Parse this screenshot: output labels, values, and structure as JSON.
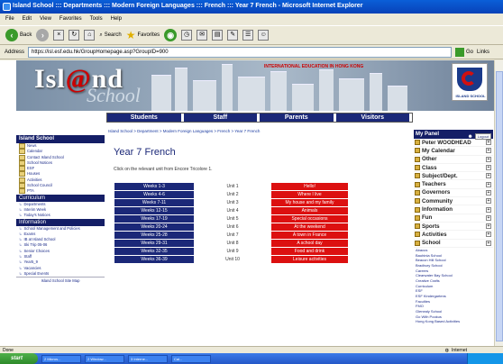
{
  "window": {
    "title": "Island School ::: Departments ::: Modern Foreign Languages ::: French ::: Year 7 French - Microsoft Internet Explorer"
  },
  "menu": [
    "File",
    "Edit",
    "View",
    "Favorites",
    "Tools",
    "Help"
  ],
  "toolbar": {
    "back": "Back",
    "search": "Search",
    "favorites": "Favorites"
  },
  "address": {
    "label": "Address",
    "url": "https://isl.esf.edu.hk/GroupHomepage.asp?GroupID=900",
    "go": "Go",
    "links": "Links"
  },
  "banner": {
    "logo_main": "Isl",
    "logo_at": "@",
    "logo_end": "nd",
    "logo_sub": "School",
    "slogan": "INTERNATIONAL EDUCATION IN HONG KONG",
    "crest_text": "ISLAND SCHOOL"
  },
  "nav": [
    "Students",
    "Staff",
    "Parents",
    "Visitors"
  ],
  "breadcrumb": "Island School > Department > Modern Foreign Languages > French > Year 7 French",
  "sidebar": {
    "title": "Island School",
    "school_items": [
      "News",
      "Calendar",
      "Contact Island School",
      "School Notices",
      "ESF",
      "Houses",
      "Activities",
      "School Council",
      "PTA"
    ],
    "curriculum_title": "Curriculum",
    "curriculum_items": [
      "Departments",
      "Interim Week",
      "Today's Notices"
    ],
    "information_title": "Information",
    "information_items": [
      "School Management and Policies",
      "Exams",
      "IB at Island School",
      "Ski Trip 05-06",
      "Senior Choices",
      "Staff",
      "Year5_9",
      "Vacancies",
      "Special Events"
    ],
    "footer": "Island School Site Map"
  },
  "main": {
    "title": "Year 7 French",
    "intro": "Click on the relevant unit from Encore Tricolore 1.",
    "rows": [
      {
        "weeks": "Weeks 1-3",
        "unit": "Unit 1",
        "topic": "Hello!"
      },
      {
        "weeks": "Weeks 4-6",
        "unit": "Unit 2",
        "topic": "Where I live"
      },
      {
        "weeks": "Weeks 7-11",
        "unit": "Unit 3",
        "topic": "My house and my family"
      },
      {
        "weeks": "Weeks 12-15",
        "unit": "Unit 4",
        "topic": "Animals"
      },
      {
        "weeks": "Weeks 17-19",
        "unit": "Unit 5",
        "topic": "Special occasions"
      },
      {
        "weeks": "Weeks 20-24",
        "unit": "Unit 6",
        "topic": "At the weekend"
      },
      {
        "weeks": "Weeks 25-28",
        "unit": "Unit 7",
        "topic": "A town in France"
      },
      {
        "weeks": "Weeks 29-31",
        "unit": "Unit 8",
        "topic": "A school day"
      },
      {
        "weeks": "Weeks 32-35",
        "unit": "Unit 9",
        "topic": "Food and drink"
      },
      {
        "weeks": "Weeks 36-39",
        "unit": "Unit 10",
        "topic": "Leisure activities"
      }
    ]
  },
  "panel": {
    "title": "My Panel",
    "logout": "Logout",
    "items": [
      "Peter WOODHEAD",
      "My Calendar",
      "Other",
      "Class",
      "Subject/Dept.",
      "Teachers",
      "Governors",
      "Community",
      "Information",
      "Fun",
      "Sports",
      "Activities",
      "School"
    ],
    "school_links": [
      "Abacus",
      "Bauhinia School",
      "Beacon Hill School",
      "Bradbury School",
      "Careers",
      "Clearwater Bay School",
      "Creative Crafts",
      "Curriculum",
      "ESF",
      "ESF Kindergartens",
      "Faculties",
      "FMO",
      "Glenealy School",
      "Go With Pookus",
      "Hong Kong Based Activities"
    ]
  },
  "status": {
    "text": "Done",
    "zone": "Internet"
  },
  "taskbar": {
    "start": "start",
    "tasks": [
      "2 Micros...",
      "2 Window...",
      "3 Interne...",
      "Cal..."
    ]
  }
}
